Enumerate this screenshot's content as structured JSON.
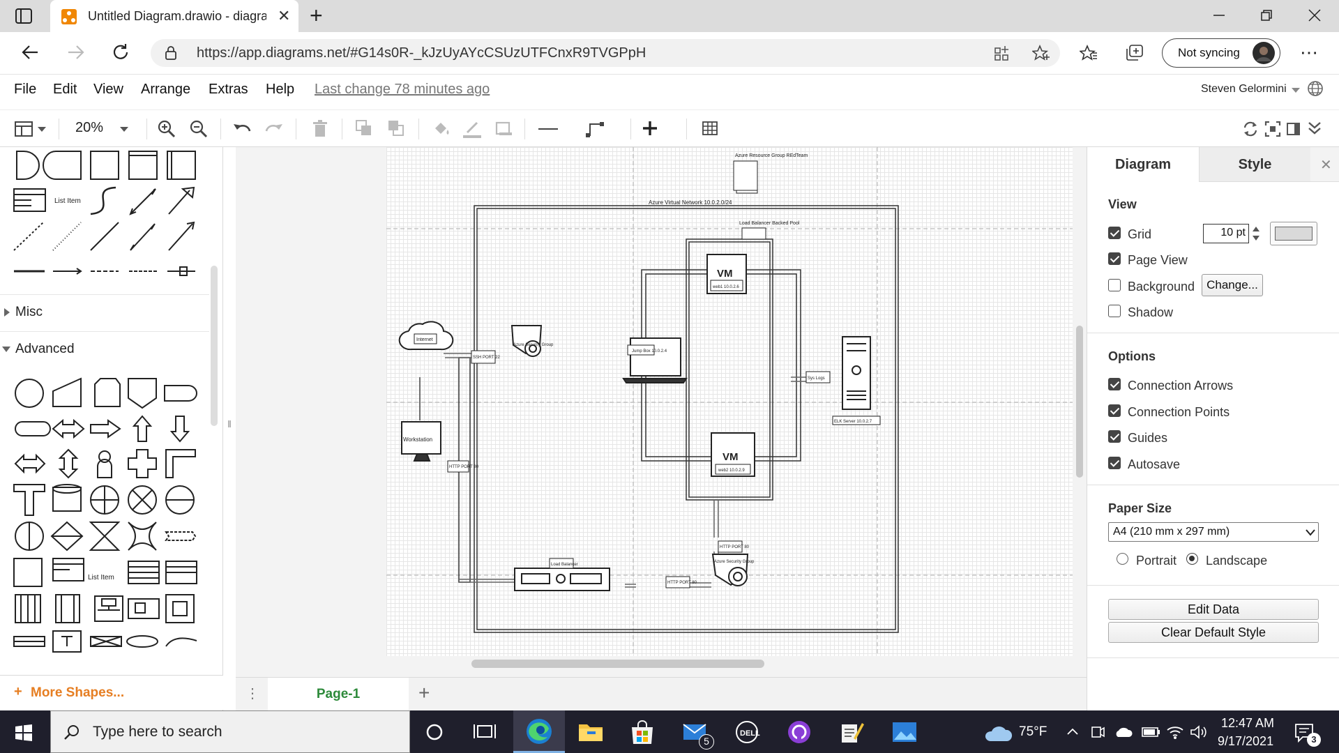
{
  "browser": {
    "tab_title": "Untitled Diagram.drawio - diagra",
    "new_tab_symbol": "+",
    "url": "https://app.diagrams.net/#G14s0R-_kJzUyAYcCSUzUTFCnxR9TVGPpH",
    "sync_label": "Not syncing",
    "window_controls": [
      "minimize-icon",
      "maximize-icon",
      "close-icon"
    ]
  },
  "app": {
    "menus": [
      "File",
      "Edit",
      "View",
      "Arrange",
      "Extras",
      "Help"
    ],
    "last_change": "Last change 78 minutes ago",
    "user": "Steven Gelormini"
  },
  "toolbar": {
    "zoom": "20%",
    "icons": [
      "format-panel-icon",
      "zoom-in-icon",
      "zoom-out-icon",
      "undo-icon",
      "redo-icon",
      "delete-icon",
      "to-front-icon",
      "to-back-icon",
      "fill-color-icon",
      "line-color-icon",
      "shadow-icon",
      "connection-icon",
      "waypoints-icon",
      "insert-icon",
      "table-icon",
      "refresh-icon",
      "fullscreen-icon",
      "format-toggle-icon",
      "collapse-icon"
    ]
  },
  "sidebar": {
    "list_item_label": "List Item",
    "sections": [
      {
        "label": "Misc",
        "expanded": false
      },
      {
        "label": "Advanced",
        "expanded": true
      }
    ],
    "more_shapes": "More Shapes..."
  },
  "diagram": {
    "resource_group": "Azure Resource Group REdTeam",
    "vnet": "Azure Virtual Network 10.0.2.0/24",
    "lb_pool": "Load Balancer Backed Pool",
    "vm_label": "VM",
    "vm1": "web1 10.0.2.6",
    "vm2": "web2 10.0.2.9",
    "jumpbox": "Jump Box 10.0.2.4",
    "internet": "Internet",
    "workstation": "Workstation",
    "ssh": "SSH PORT 22",
    "http1": "HTTP PORT 80",
    "http2": "HTTP PORT 80",
    "http3": "HTTP PORT 80",
    "nsg1": "Azure Security Group",
    "nsg2": "Azure Security Group",
    "syslogs": "Sys Logs",
    "elk": "ELK Server 10.0.2.7",
    "lb": "Load Balancer"
  },
  "pages": {
    "current": "Page-1",
    "add_symbol": "+"
  },
  "format_panel": {
    "tabs": [
      "Diagram",
      "Style"
    ],
    "view_heading": "View",
    "grid_label": "Grid",
    "grid_checked": true,
    "grid_size": "10 pt",
    "page_view_label": "Page View",
    "page_view_checked": true,
    "background_label": "Background",
    "background_checked": false,
    "change_button": "Change...",
    "shadow_label": "Shadow",
    "shadow_checked": false,
    "options_heading": "Options",
    "options": [
      {
        "label": "Connection Arrows",
        "checked": true
      },
      {
        "label": "Connection Points",
        "checked": true
      },
      {
        "label": "Guides",
        "checked": true
      },
      {
        "label": "Autosave",
        "checked": true
      }
    ],
    "paper_heading": "Paper Size",
    "paper_size": "A4 (210 mm x 297 mm)",
    "portrait": "Portrait",
    "landscape": "Landscape",
    "orientation": "Landscape",
    "edit_data": "Edit Data",
    "clear_style": "Clear Default Style"
  },
  "taskbar": {
    "search_placeholder": "Type here to search",
    "temperature": "75°F",
    "time": "12:47 AM",
    "date": "9/17/2021",
    "mail_badge": "5",
    "notification_badge": "3",
    "accent": "#0078d4"
  }
}
